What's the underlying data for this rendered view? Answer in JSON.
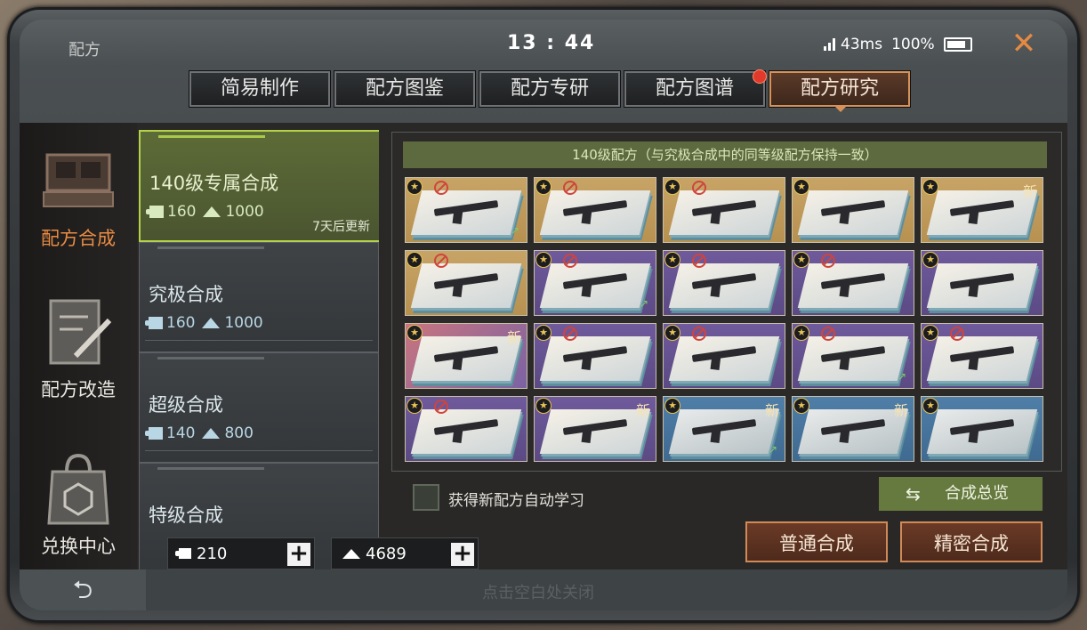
{
  "app": {
    "title": "配方"
  },
  "statusbar": {
    "time": "13 : 44",
    "ping": "43ms",
    "battery": "100%"
  },
  "tabs": [
    {
      "label": "简易制作",
      "active": false,
      "badge": false
    },
    {
      "label": "配方图鉴",
      "active": false,
      "badge": false
    },
    {
      "label": "配方专研",
      "active": false,
      "badge": false
    },
    {
      "label": "配方图谱",
      "active": false,
      "badge": true
    },
    {
      "label": "配方研究",
      "active": true,
      "badge": false
    }
  ],
  "leftnav": [
    {
      "label": "配方合成",
      "icon": "terminal-icon",
      "active": true
    },
    {
      "label": "配方改造",
      "icon": "blueprint-pen-icon",
      "active": false
    },
    {
      "label": "兑换中心",
      "icon": "shop-bag-icon",
      "active": false
    }
  ],
  "recipes": [
    {
      "name": "140级专属合成",
      "pieces": "160",
      "ingots": "1000",
      "refresh": "7天后更新",
      "active": true
    },
    {
      "name": "究极合成",
      "pieces": "160",
      "ingots": "1000",
      "refresh": "",
      "active": false
    },
    {
      "name": "超级合成",
      "pieces": "140",
      "ingots": "800",
      "refresh": "",
      "active": false
    },
    {
      "name": "特级合成",
      "pieces": "",
      "ingots": "",
      "refresh": "",
      "active": false
    }
  ],
  "resources": {
    "pieces": "210",
    "ingots": "4689"
  },
  "grid_header": "140级配方（与究极合成中的同等级配方保持一致）",
  "cards": [
    {
      "rarity": "gold",
      "locked": true,
      "new": false,
      "trend": true
    },
    {
      "rarity": "gold",
      "locked": true,
      "new": false,
      "trend": false
    },
    {
      "rarity": "gold",
      "locked": true,
      "new": false,
      "trend": false
    },
    {
      "rarity": "gold",
      "locked": false,
      "new": false,
      "trend": false
    },
    {
      "rarity": "gold",
      "locked": false,
      "new": true,
      "trend": false
    },
    {
      "rarity": "gold",
      "locked": true,
      "new": false,
      "trend": false
    },
    {
      "rarity": "purple",
      "locked": true,
      "new": false,
      "trend": true
    },
    {
      "rarity": "purple",
      "locked": true,
      "new": false,
      "trend": false
    },
    {
      "rarity": "purple",
      "locked": true,
      "new": false,
      "trend": false
    },
    {
      "rarity": "purple",
      "locked": false,
      "new": false,
      "trend": false
    },
    {
      "rarity": "pink",
      "locked": false,
      "new": true,
      "trend": false
    },
    {
      "rarity": "purple",
      "locked": true,
      "new": false,
      "trend": false
    },
    {
      "rarity": "purple",
      "locked": true,
      "new": false,
      "trend": false
    },
    {
      "rarity": "purple",
      "locked": true,
      "new": false,
      "trend": true
    },
    {
      "rarity": "purple",
      "locked": true,
      "new": false,
      "trend": false
    },
    {
      "rarity": "purple",
      "locked": true,
      "new": false,
      "trend": false
    },
    {
      "rarity": "purple",
      "locked": false,
      "new": true,
      "trend": false
    },
    {
      "rarity": "blue",
      "locked": false,
      "new": true,
      "trend": true
    },
    {
      "rarity": "blue",
      "locked": false,
      "new": true,
      "trend": false
    },
    {
      "rarity": "blue",
      "locked": false,
      "new": false,
      "trend": false
    }
  ],
  "card_new_label": "新",
  "auto_learn": {
    "label": "获得新配方自动学习",
    "checked": false
  },
  "buttons": {
    "overview": "合成总览",
    "normal": "普通合成",
    "precise": "精密合成"
  },
  "footer": {
    "hint": "点击空白处关闭"
  },
  "colors": {
    "accent_orange": "#e88b43",
    "active_green": "#b3d24a",
    "badge_red": "#e23a2a"
  }
}
